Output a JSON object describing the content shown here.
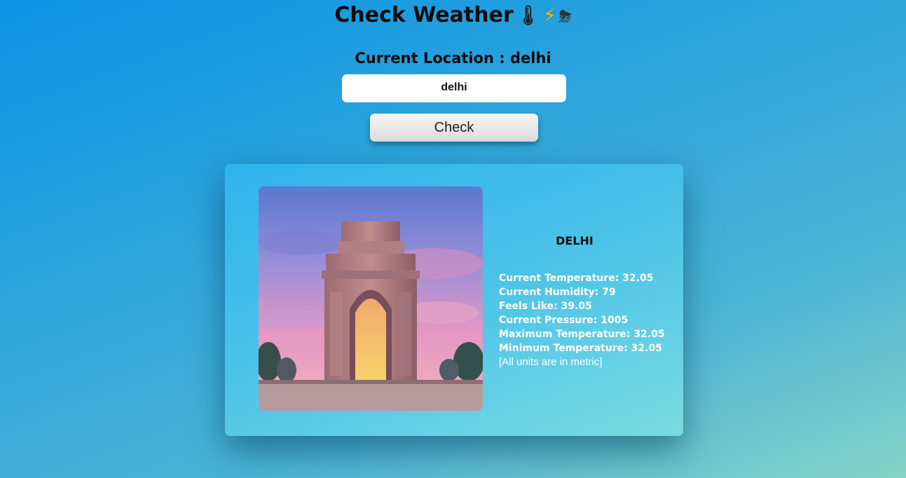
{
  "header": {
    "title": "Check Weather",
    "emojis": [
      "🌡",
      "⚡",
      "⛈"
    ]
  },
  "location": {
    "heading": "Current Location : delhi"
  },
  "search": {
    "value": "delhi"
  },
  "check_button": {
    "label": "Check"
  },
  "card": {
    "city": "DELHI",
    "photo_icon": "india-gate-photo",
    "stats": [
      "Current Temperature: 32.05",
      "Current Humidity: 79",
      "Feels Like: 39.05",
      "Current Pressure: 1005",
      "Maximum Temperature: 32.05",
      "Minimum Temperature: 32.05"
    ],
    "note": "[All units are in metric]"
  }
}
